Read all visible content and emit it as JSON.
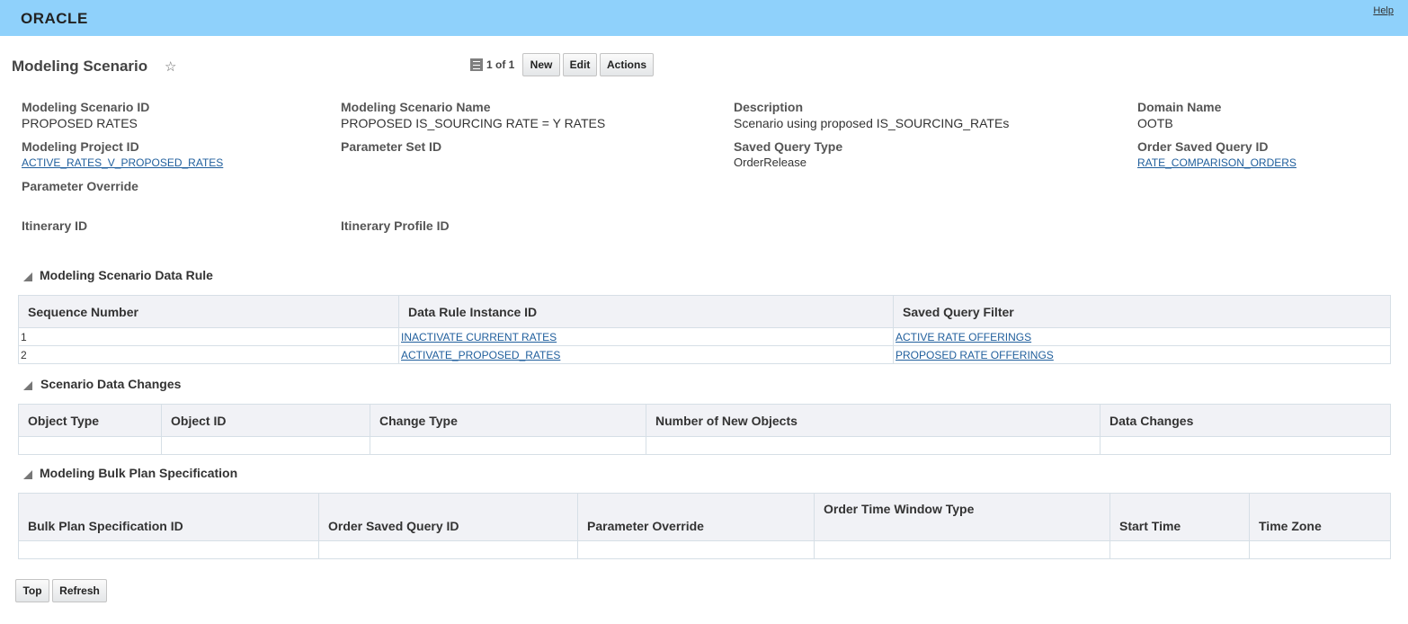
{
  "header": {
    "logo": "ORACLE",
    "help": "Help"
  },
  "page": {
    "title": "Modeling Scenario",
    "record_count": "1 of 1",
    "buttons": {
      "new": "New",
      "edit": "Edit",
      "actions": "Actions"
    }
  },
  "fields": {
    "scenario_id": {
      "label": "Modeling Scenario ID",
      "value": "PROPOSED RATES"
    },
    "scenario_name": {
      "label": "Modeling Scenario Name",
      "value": "PROPOSED IS_SOURCING RATE = Y RATES"
    },
    "description": {
      "label": "Description",
      "value": "Scenario using proposed IS_SOURCING_RATEs"
    },
    "domain_name": {
      "label": "Domain Name",
      "value": "OOTB"
    },
    "project_id": {
      "label": "Modeling Project ID",
      "value": "ACTIVE_RATES_V_PROPOSED_RATES"
    },
    "parameter_set_id": {
      "label": "Parameter Set ID",
      "value": ""
    },
    "saved_query_type": {
      "label": "Saved Query Type",
      "value": "OrderRelease"
    },
    "order_saved_query_id": {
      "label": "Order Saved Query ID",
      "value": "RATE_COMPARISON_ORDERS"
    },
    "parameter_override": {
      "label": "Parameter Override",
      "value": ""
    },
    "itinerary_id": {
      "label": "Itinerary ID",
      "value": ""
    },
    "itinerary_profile_id": {
      "label": "Itinerary Profile ID",
      "value": ""
    }
  },
  "data_rule": {
    "title": "Modeling Scenario Data Rule",
    "columns": [
      "Sequence Number",
      "Data Rule Instance ID",
      "Saved Query Filter"
    ],
    "rows": [
      {
        "seq": "1",
        "rule": "INACTIVATE CURRENT RATES",
        "filter": "ACTIVE RATE OFFERINGS"
      },
      {
        "seq": "2",
        "rule": "ACTIVATE_PROPOSED_RATES",
        "filter": "PROPOSED RATE OFFERINGS"
      }
    ]
  },
  "data_changes": {
    "title": "Scenario Data Changes",
    "columns": [
      "Object Type",
      "Object ID",
      "Change Type",
      "Number of New Objects",
      "Data Changes"
    ]
  },
  "bulk_plan": {
    "title": "Modeling Bulk Plan Specification",
    "columns": [
      "Bulk Plan Specification ID",
      "Order Saved Query ID",
      "Parameter Override",
      "Order Time Window Type",
      "Start Time",
      "Time Zone"
    ]
  },
  "footer": {
    "top": "Top",
    "refresh": "Refresh"
  }
}
